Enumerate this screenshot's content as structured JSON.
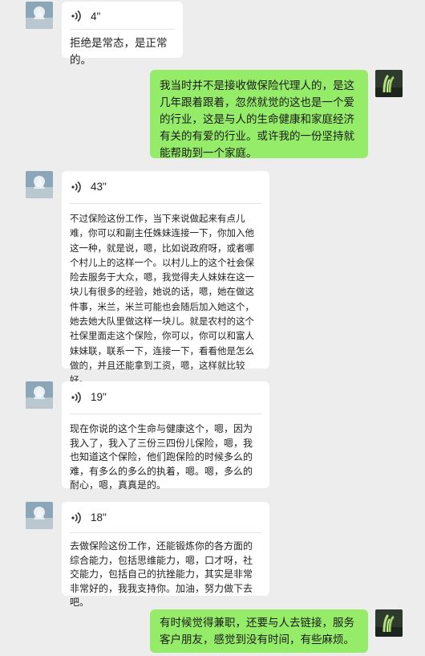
{
  "messages": [
    {
      "dir": "in",
      "type": "voice",
      "duration": "4\"",
      "transcript": "拒绝是常态，是正常的。"
    },
    {
      "dir": "out",
      "type": "text",
      "text": "我当时并不是接收做保险代理人的，是这几年跟着跟着，忽然就觉的这也是一个爱的行业，这是与人的生命健康和家庭经济有关的有爱的行业。或许我的一份坚持就能帮助到一个家庭。"
    },
    {
      "dir": "in",
      "type": "voice",
      "duration": "43\"",
      "transcript": "不过保险这份工作，当下来说做起来有点儿难，你可以和副主任姝妹连接一下，你加入他这一种，就是说，嗯，比如说政府呀，或者哪个村儿上的这样一个。以村儿上的这个社会保险去服务于大众，嗯，我觉得夫人妹妹在这一块儿有很多的经验，她说的话，嗯，她在做这件事，米兰，米兰可能也会随后加入她这个，她去她大队里做这样一块儿。就是农村的这个社保里面走这个保险，你可以，你可以和富人妹妹联，联系一下，连接一下，看看他是怎么做的，并且还能拿到工资，嗯，这样就比较好。"
    },
    {
      "dir": "in",
      "type": "voice",
      "duration": "19\"",
      "transcript": "现在你说的这个生命与健康这个，嗯，因为我入了，我入了三份三四份儿保险，嗯，我也知道这个保险，他们跑保险的时候多么的难，有多么的多么的执着，嗯。嗯，多么的耐心，嗯，真真是的。"
    },
    {
      "dir": "in",
      "type": "voice",
      "duration": "18\"",
      "transcript": "去做保险这份工作，还能锻炼你的各方面的综合能力，包括思维能力，嗯，口才呀，社交能力，包括自己的抗挫能力，其实是非常非常好的，我我支持你。加油，努力做下去吧。"
    },
    {
      "dir": "out",
      "type": "text",
      "text": "有时候觉得兼职，还要与人去链接，服务客户朋友，感觉到没有时间，有些麻烦。"
    }
  ]
}
